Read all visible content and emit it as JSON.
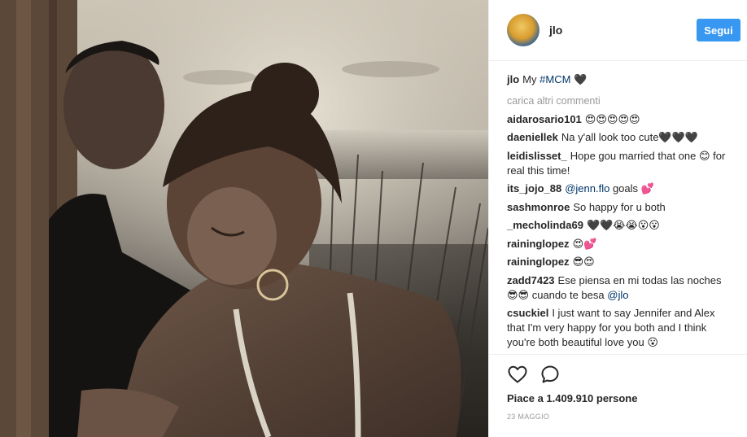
{
  "post": {
    "photo_description_icon": "photo",
    "colors": {
      "accent": "#3897f0",
      "link": "#003569",
      "muted": "#999999",
      "text": "#262626",
      "divider": "#efefef"
    }
  },
  "header": {
    "username": "jlo",
    "follow_label": "Segui"
  },
  "caption": {
    "username": "jlo",
    "text_before": "My",
    "hashtag": "#MCM",
    "emoji": "🖤"
  },
  "load_more": "carica altri commenti",
  "comments": [
    {
      "username": "aidarosario101",
      "text": "😍😍😍😍😍"
    },
    {
      "username": "daeniellek",
      "text": "Na y'all look too cute🖤🖤🖤"
    },
    {
      "username": "leidislisset_",
      "text": "Hope gou married that one 😊 for real this time!"
    },
    {
      "username": "its_jojo_88",
      "mention": "@jenn.flo",
      "text": "goals 💕"
    },
    {
      "username": "sashmonroe",
      "text": "So happy for u both"
    },
    {
      "username": "_mecholinda69",
      "text": "🖤🖤😭😭😮😮"
    },
    {
      "username": "raininglopez",
      "text": "😍💕"
    },
    {
      "username": "raininglopez",
      "text": "😎😍"
    },
    {
      "username": "zadd7423",
      "text": "Ese piensa en mi todas las noches😎😎 cuando te besa",
      "mention": "@jlo"
    },
    {
      "username": "csuckiel",
      "text": "I just want to say Jennifer and Alex that I'm very happy for you both and I think you're both beautiful love you 😮"
    }
  ],
  "actions": {
    "like_icon": "heart-outline",
    "comment_icon": "speech-bubble"
  },
  "likes_text": "Piace a 1.409.910 persone",
  "date": "23 MAGGIO"
}
